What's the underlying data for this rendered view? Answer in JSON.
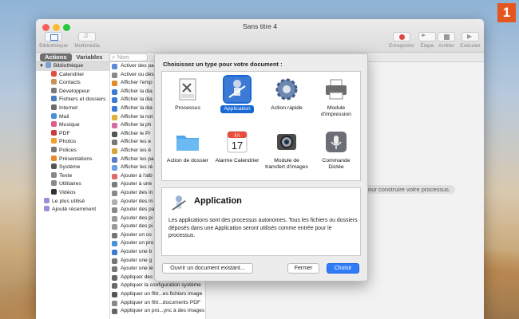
{
  "badge": "1",
  "window": {
    "title": "Sans titre 4"
  },
  "toolbar": {
    "library": "Bibliothèque",
    "media": "Multimédia",
    "record": "Enregistrer",
    "step": "Étape",
    "stop": "Arrêter",
    "run": "Exécuter"
  },
  "tabs": {
    "actions": "Actions",
    "variables": "Variables"
  },
  "search": {
    "placeholder": "Nom"
  },
  "library": {
    "header": "Bibliothèque",
    "items": [
      "Calendrier",
      "Contacts",
      "Développeur",
      "Fichiers et dossiers",
      "Internet",
      "Mail",
      "Musique",
      "PDF",
      "Photos",
      "Polices",
      "Présentations",
      "Système",
      "Texte",
      "Utilitaires",
      "Vidéos"
    ],
    "top": [
      "Le plus utilisé",
      "Ajouté récemment"
    ]
  },
  "actions": [
    "Activer des pa",
    "Activer ou dés",
    "Afficher l'emp",
    "Afficher la dia",
    "Afficher la dia",
    "Afficher la dia",
    "Afficher la not",
    "Afficher la ph",
    "Afficher le Pr",
    "Afficher les e",
    "Afficher les é",
    "Afficher les pa",
    "Afficher les ré",
    "Ajouter à l'alb",
    "Ajouter à une",
    "Ajouter des in",
    "Ajouter des m",
    "Ajouter des pa",
    "Ajouter des pi",
    "Ajouter des pi",
    "Ajouter un co",
    "Ajouter un pro",
    "Ajouter une b",
    "Ajouter une g",
    "Ajouter une lé",
    "Appliquer des",
    "Appliquer la configuration système",
    "Appliquer un filtr...es fichiers image",
    "Appliquer un filtr...documents PDF",
    "Appliquer un pro...ync à des images"
  ],
  "workflow_hint": "pour construire votre processus.",
  "sheet": {
    "title": "Choisissez un type pour votre document :",
    "types": [
      {
        "label": "Processus"
      },
      {
        "label": "Application"
      },
      {
        "label": "Action rapide"
      },
      {
        "label": "Module d'impression"
      },
      {
        "label": "Action de dossier"
      },
      {
        "label": "Alarme Calendrier"
      },
      {
        "label": "Module de transfert d'images"
      },
      {
        "label": "Commande Dictée"
      }
    ],
    "calendar_month": "JUL",
    "calendar_day": "17",
    "workflow_badge": "WFLOW",
    "desc_title": "Application",
    "desc_text": "Les applications sont des processus autonomes. Tous les fichiers ou dossiers déposés dans une Application seront utilisés comme entrée pour le processus.",
    "btn_open": "Ouvrir un document existant...",
    "btn_close": "Fermer",
    "btn_choose": "Choisir"
  }
}
